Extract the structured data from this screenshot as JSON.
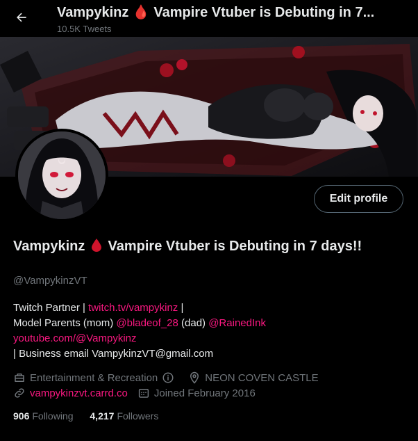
{
  "header": {
    "title": "Vampykinz 🩸 Vampire Vtuber is Debuting in 7...",
    "tweet_count": "10.5K Tweets"
  },
  "profile": {
    "name_part1": "Vampykinz",
    "name_part2": "Vampire Vtuber is Debuting in 7 days!!",
    "handle": "@VampykinzVT",
    "edit_label": "Edit profile"
  },
  "bio": {
    "line1_text": "Twitch Partner | ",
    "line1_link": "twitch.tv/vampykinz",
    "line1_tail": " |",
    "line2_text": "Model Parents (mom) ",
    "line2_link1": "@bladeof_28",
    "line2_mid": " (dad) ",
    "line2_link2": "@RainedInk",
    "line3_link": "youtube.com/@Vampykinz",
    "line4_text": "| Business email VampykinzVT@gmail.com"
  },
  "meta": {
    "category": "Entertainment & Recreation",
    "location": "NEON COVEN CASTLE",
    "website": "vampykinzvt.carrd.co",
    "joined": "Joined February 2016"
  },
  "stats": {
    "following_count": "906",
    "following_label": "Following",
    "followers_count": "4,217",
    "followers_label": "Followers"
  },
  "colors": {
    "accent": "#f91880",
    "muted": "#71767b",
    "text": "#e7e9ea",
    "background": "#000000"
  }
}
